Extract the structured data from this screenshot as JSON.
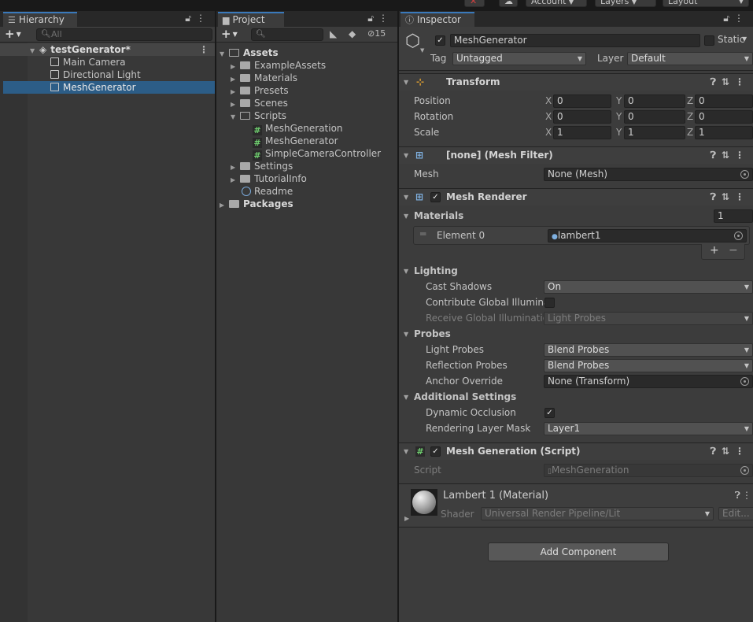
{
  "toolbar": {
    "account_label": "Account",
    "layers_label": "Layers",
    "layout_label": "Layout"
  },
  "hierarchy": {
    "tab_label": "Hierarchy",
    "search_placeholder": "All",
    "scene_name": "testGenerator*",
    "items": [
      "Main Camera",
      "Directional Light",
      "MeshGenerator"
    ],
    "selected": "MeshGenerator"
  },
  "project": {
    "tab_label": "Project",
    "hidden_count": "15",
    "tree": {
      "assets": "Assets",
      "example_assets": "ExampleAssets",
      "materials": "Materials",
      "presets": "Presets",
      "scenes": "Scenes",
      "scripts": "Scripts",
      "script_files": [
        "MeshGeneration",
        "MeshGenerator",
        "SimpleCameraController"
      ],
      "settings": "Settings",
      "tutorial_info": "TutorialInfo",
      "readme": "Readme",
      "packages": "Packages"
    }
  },
  "inspector": {
    "tab_label": "Inspector",
    "object_name": "MeshGenerator",
    "static_label": "Static",
    "tag_label": "Tag",
    "tag_value": "Untagged",
    "layer_label": "Layer",
    "layer_value": "Default",
    "transform": {
      "title": "Transform",
      "rows": [
        {
          "label": "Position",
          "x": "0",
          "y": "0",
          "z": "0"
        },
        {
          "label": "Rotation",
          "x": "0",
          "y": "0",
          "z": "0"
        },
        {
          "label": "Scale",
          "x": "1",
          "y": "1",
          "z": "1"
        }
      ],
      "axis_x": "X",
      "axis_y": "Y",
      "axis_z": "Z"
    },
    "mesh_filter": {
      "title": "[none] (Mesh Filter)",
      "mesh_label": "Mesh",
      "mesh_value": "None (Mesh)"
    },
    "mesh_renderer": {
      "title": "Mesh Renderer",
      "materials_label": "Materials",
      "materials_count": "1",
      "element_label": "Element 0",
      "element_value": "lambert1",
      "add": "+",
      "remove": "−",
      "lighting_label": "Lighting",
      "cast_shadows_label": "Cast Shadows",
      "cast_shadows_value": "On",
      "contribute_gi_label": "Contribute Global Illuminat",
      "receive_gi_label": "Receive Global Illumination",
      "receive_gi_value": "Light Probes",
      "probes_label": "Probes",
      "light_probes_label": "Light Probes",
      "light_probes_value": "Blend Probes",
      "reflection_probes_label": "Reflection Probes",
      "reflection_probes_value": "Blend Probes",
      "anchor_override_label": "Anchor Override",
      "anchor_override_value": "None (Transform)",
      "additional_label": "Additional Settings",
      "dynamic_occlusion_label": "Dynamic Occlusion",
      "rendering_layer_label": "Rendering Layer Mask",
      "rendering_layer_value": "Layer1"
    },
    "mesh_generation": {
      "title": "Mesh Generation (Script)",
      "script_label": "Script",
      "script_value": "MeshGeneration"
    },
    "material": {
      "title": "Lambert 1 (Material)",
      "shader_label": "Shader",
      "shader_value": "Universal Render Pipeline/Lit",
      "edit_label": "Edit..."
    },
    "add_component_label": "Add Component"
  }
}
